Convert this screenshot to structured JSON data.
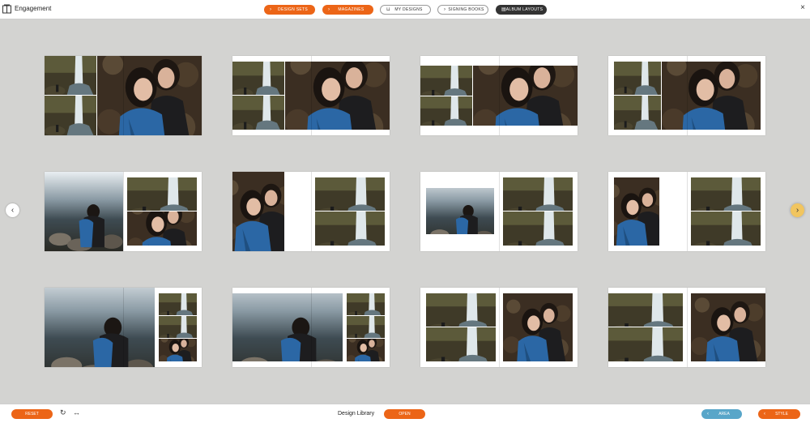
{
  "header": {
    "title": "Engagement",
    "buttons": {
      "design_sets": "DESIGN SETS",
      "magazines": "MAGAZINES",
      "my_designs": "MY DESIGNS",
      "signing_books": "SIGNING BOOKS",
      "album_layouts": "ALBUM LAYOUTS"
    },
    "icons": {
      "app": "album-book-icon",
      "my_designs": "tray-icon",
      "album_layouts": "album-icon",
      "close": "close-icon"
    }
  },
  "library": {
    "spreads": [
      {
        "layout": "2 small left + 1 large right, full bleed"
      },
      {
        "layout": "2 small + 1 large, white margins"
      },
      {
        "layout": "2 small + 1 large, centered band"
      },
      {
        "layout": "2 small + 1 large, right aligned"
      },
      {
        "layout": "1 large left + 2 stacked right"
      },
      {
        "layout": "portrait left + 2 stacked right"
      },
      {
        "layout": "landscape left + 2 stacked right"
      },
      {
        "layout": "portrait left + 2 stacked right, margins"
      },
      {
        "layout": "panorama left + 3 stacked right"
      },
      {
        "layout": "panorama left + 3 stacked right, margins"
      },
      {
        "layout": "2 stacked left + 1 large right"
      },
      {
        "layout": "2 stacked left + 1 large right, margins"
      }
    ]
  },
  "footer": {
    "reset": "RESET",
    "title": "Design Library",
    "open": "OPEN",
    "area": "AREA",
    "style": "STYLE",
    "icons": {
      "refresh": "refresh-icon",
      "swap": "swap-arrows-icon"
    }
  },
  "colors": {
    "accent": "#ec6517",
    "blue": "#58a6c9",
    "dark": "#333333",
    "background": "#d3d3d1"
  }
}
